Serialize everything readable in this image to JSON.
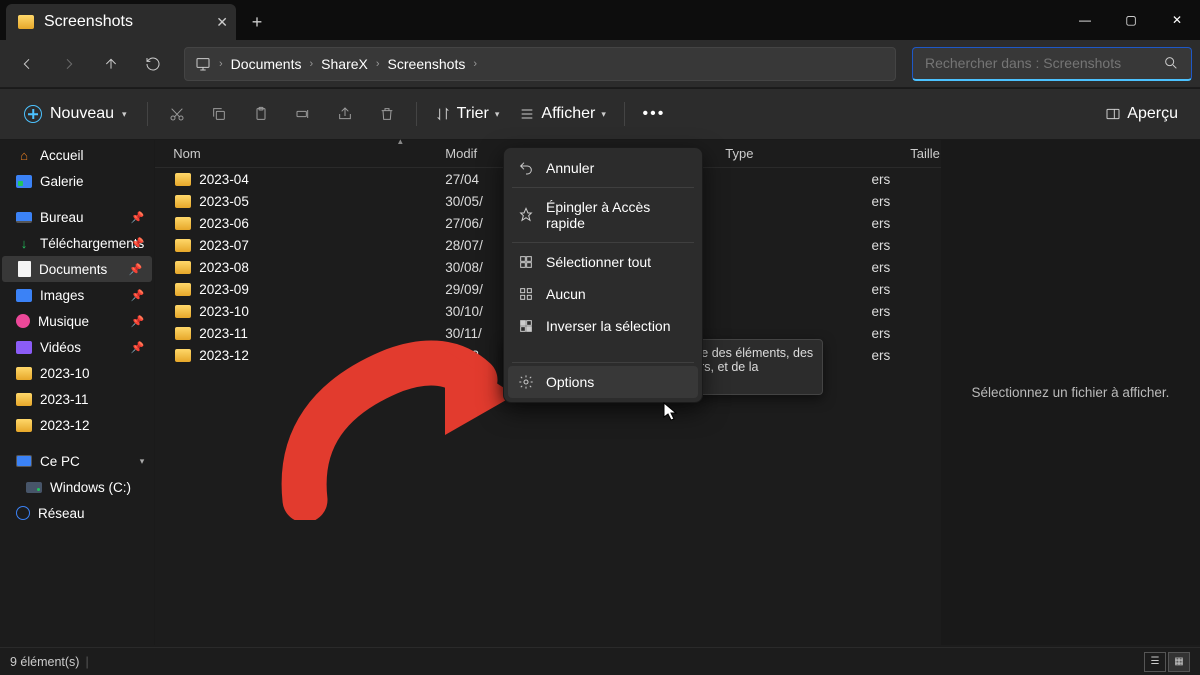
{
  "tab": {
    "title": "Screenshots"
  },
  "window_controls": {
    "min": "—",
    "max": "▢",
    "close": "✕"
  },
  "breadcrumbs": [
    "Documents",
    "ShareX",
    "Screenshots"
  ],
  "search": {
    "placeholder": "Rechercher dans : Screenshots"
  },
  "toolbar": {
    "new": "Nouveau",
    "sort": "Trier",
    "view": "Afficher",
    "preview": "Aperçu"
  },
  "columns": {
    "name": "Nom",
    "modified": "Modif",
    "type": "Type",
    "size": "Taille"
  },
  "sidebar": {
    "home": "Accueil",
    "gallery": "Galerie",
    "desktop": "Bureau",
    "downloads": "Téléchargements",
    "documents": "Documents",
    "images": "Images",
    "music": "Musique",
    "videos": "Vidéos",
    "f1": "2023-10",
    "f2": "2023-11",
    "f3": "2023-12",
    "thispc": "Ce PC",
    "drive": "Windows (C:)",
    "network": "Réseau"
  },
  "rows": [
    {
      "name": "2023-04",
      "date": "27/04",
      "type": "ers"
    },
    {
      "name": "2023-05",
      "date": "30/05/",
      "type": "ers"
    },
    {
      "name": "2023-06",
      "date": "27/06/",
      "type": "ers"
    },
    {
      "name": "2023-07",
      "date": "28/07/",
      "type": "ers"
    },
    {
      "name": "2023-08",
      "date": "30/08/",
      "type": "ers"
    },
    {
      "name": "2023-09",
      "date": "29/09/",
      "type": "ers"
    },
    {
      "name": "2023-10",
      "date": "30/10/",
      "type": "ers"
    },
    {
      "name": "2023-11",
      "date": "30/11/",
      "type": "ers"
    },
    {
      "name": "2023-12",
      "date": "07/12",
      "type": "ers"
    }
  ],
  "context_menu": {
    "undo": "Annuler",
    "pin": "Épingler à Accès rapide",
    "select_all": "Sélectionner tout",
    "select_none": "Aucun",
    "invert": "Inverser la sélection",
    "options": "Options"
  },
  "tooltip": "Modifier les paramètres d'ouverture des éléments, des affichages de fichiers et de dossiers, et de la recherche.",
  "preview_pane": "Sélectionnez un fichier à afficher.",
  "status": "9 élément(s)"
}
